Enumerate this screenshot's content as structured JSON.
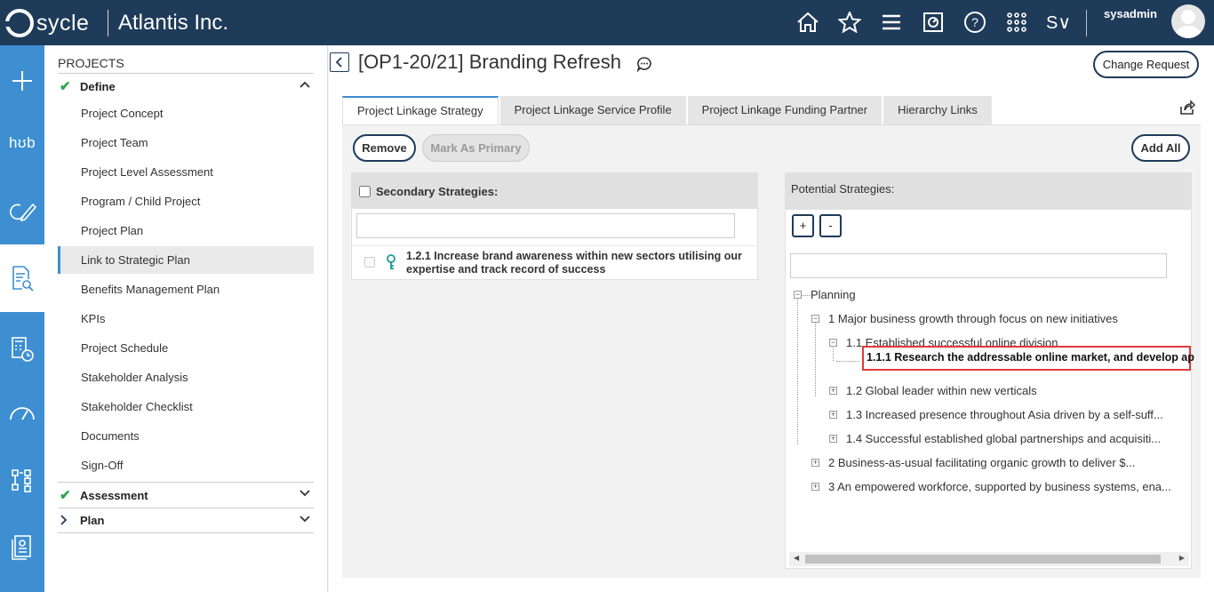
{
  "app": {
    "logo_text": "sycle",
    "company": "Atlantis Inc.",
    "username": "sysadmin",
    "top_icons": [
      "home-icon",
      "star-icon",
      "menu-icon",
      "dashboard-icon",
      "help-icon",
      "apps-grid-icon",
      "signature-icon"
    ],
    "signature_label": "S∨"
  },
  "rail": {
    "items": [
      "add-icon",
      "hub",
      "refresh-edit-icon",
      "document-search-icon",
      "calculator-clock-icon",
      "gauge-icon",
      "hierarchy-icon",
      "report-icon"
    ],
    "hub_label": "hʊb"
  },
  "projects": {
    "title": "PROJECTS",
    "sections": [
      {
        "label": "Define",
        "status": "complete",
        "expanded": true
      },
      {
        "label": "Assessment",
        "status": "complete",
        "expanded": false
      },
      {
        "label": "Plan",
        "status": "pending",
        "expanded": false
      }
    ],
    "define_items": [
      "Project Concept",
      "Project Team",
      "Project Level Assessment",
      "Program / Child Project",
      "Project Plan",
      "Link to Strategic Plan",
      "Benefits Management Plan",
      "KPIs",
      "Project Schedule",
      "Stakeholder Analysis",
      "Stakeholder Checklist",
      "Documents",
      "Sign-Off"
    ],
    "active_item": "Link to Strategic Plan"
  },
  "page": {
    "title": "[OP1-20/21] Branding Refresh",
    "change_request_label": "Change Request"
  },
  "tabs": [
    {
      "label": "Project Linkage Strategy",
      "active": true
    },
    {
      "label": "Project Linkage Service Profile",
      "active": false
    },
    {
      "label": "Project Linkage Funding Partner",
      "active": false
    },
    {
      "label": "Hierarchy Links",
      "active": false
    }
  ],
  "actions": {
    "remove_label": "Remove",
    "mark_primary_label": "Mark As Primary",
    "add_all_label": "Add All"
  },
  "secondary": {
    "header": "Secondary Strategies:",
    "filter_value": "",
    "items": [
      "1.2.1 Increase brand awareness within new sectors utilising our expertise and track record of success"
    ]
  },
  "potential": {
    "header": "Potential Strategies:",
    "expand_label": "+",
    "collapse_label": "-",
    "filter_value": "",
    "tree": {
      "root": "Planning",
      "n1": "1 Major business growth through focus on new initiatives",
      "n11": "1.1 Established successful online division",
      "n111": "1.1.1 Research the addressable online market, and develop ap",
      "n12": "1.2 Global leader within new verticals",
      "n13": "1.3 Increased presence throughout Asia driven by a self-suff...",
      "n14": "1.4 Successful established global partnerships and acquisiti...",
      "n2": "2 Business-as-usual facilitating organic growth to deliver $...",
      "n3": "3 An empowered workforce, supported by business systems, ena..."
    }
  },
  "colors": {
    "topbar": "#1f3b5a",
    "rail": "#3d8fd1",
    "check": "#2ca34a",
    "highlight_border": "#e0393e"
  }
}
